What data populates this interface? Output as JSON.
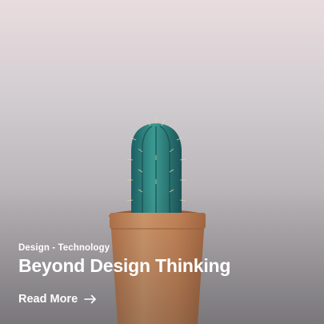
{
  "card": {
    "category": "Design - Technology",
    "title": "Beyond Design Thinking",
    "read_more_label": "Read More",
    "read_more_icon": "arrow-right-icon"
  },
  "colors": {
    "text": "#ffffff",
    "pot": "#c98a5a",
    "cactus": "#2f7f7a",
    "background_top": "#e9dcde",
    "background_bottom": "#9d9a9e"
  }
}
